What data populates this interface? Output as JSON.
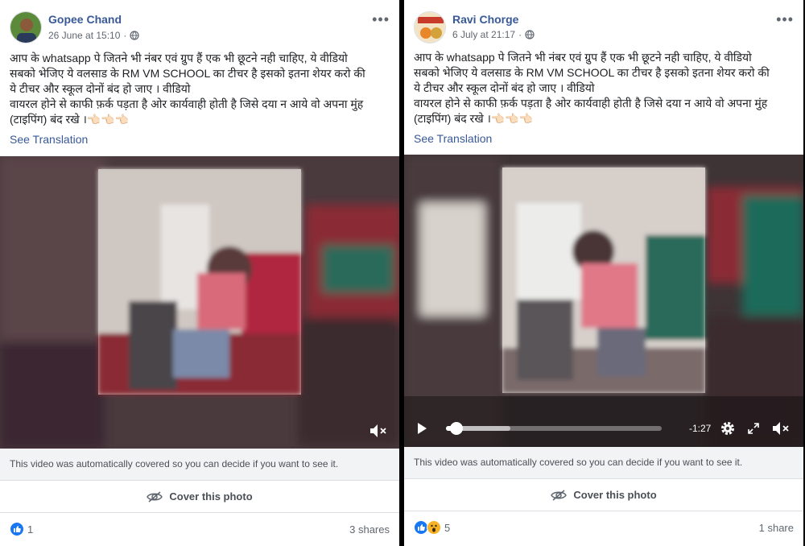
{
  "posts": [
    {
      "author": "Gopee Chand",
      "timestamp": "26 June at 15:10",
      "privacy_icon": "globe-icon",
      "text_lines": [
        "आप के whatsapp पे जितने भी नंबर एवं ग्रुप हैं एक भी छूटने नही चाहिए, ये वीडियो",
        "सबको भेजिए ये वलसाड के RM VM SCHOOL का टीचर है इसको इतना शेयर करो की",
        "ये टीचर और स्कूल दोनों बंद हो जाए । वीडियो",
        "वायरल होने से काफी फ़र्क पड़ता है ओर कार्यवाही होती है जिसे दया न आये वो अपना मुंह",
        "(टाइपिंग) बंद रखे ।👈🏻👈🏻👈🏻"
      ],
      "see_translation": "See Translation",
      "video_notice": "This video was automatically covered so you can decide if you want to see it.",
      "cover_label": "Cover this photo",
      "reaction_count": "1",
      "reactions": [
        "like"
      ],
      "shares": "3 shares",
      "has_controls": false
    },
    {
      "author": "Ravi Chorge",
      "timestamp": "6 July at 21:17",
      "privacy_icon": "globe-icon",
      "text_lines": [
        "आप के whatsapp पे जितने भी नंबर एवं ग्रुप हैं एक भी छूटने नही चाहिए, ये वीडियो",
        "सबको भेजिए ये वलसाड के RM VM SCHOOL का टीचर है इसको इतना शेयर करो की",
        "ये टीचर और स्कूल दोनों बंद हो जाए । वीडियो",
        "वायरल होने से काफी फ़र्क पड़ता है ओर कार्यवाही होती है जिसे दया न आये वो अपना मुंह",
        "(टाइपिंग) बंद रखे ।👈🏻👈🏻👈🏻"
      ],
      "see_translation": "See Translation",
      "video_notice": "This video was automatically covered so you can decide if you want to see it.",
      "cover_label": "Cover this photo",
      "reaction_count": "5",
      "reactions": [
        "like",
        "wow"
      ],
      "shares": "1 share",
      "has_controls": true,
      "video_time_remaining": "-1:27",
      "video_progress": 0.05,
      "video_buffered": 0.3
    }
  ],
  "colors": {
    "link": "#385898",
    "like": "#1877f2",
    "wow": "#f7b125",
    "background": "#ffffff",
    "divider": "#000000"
  },
  "icons": [
    "more-options-icon",
    "globe-icon",
    "mute-icon",
    "play-icon",
    "settings-icon",
    "fullscreen-icon",
    "hide-icon",
    "like-icon",
    "wow-icon"
  ]
}
